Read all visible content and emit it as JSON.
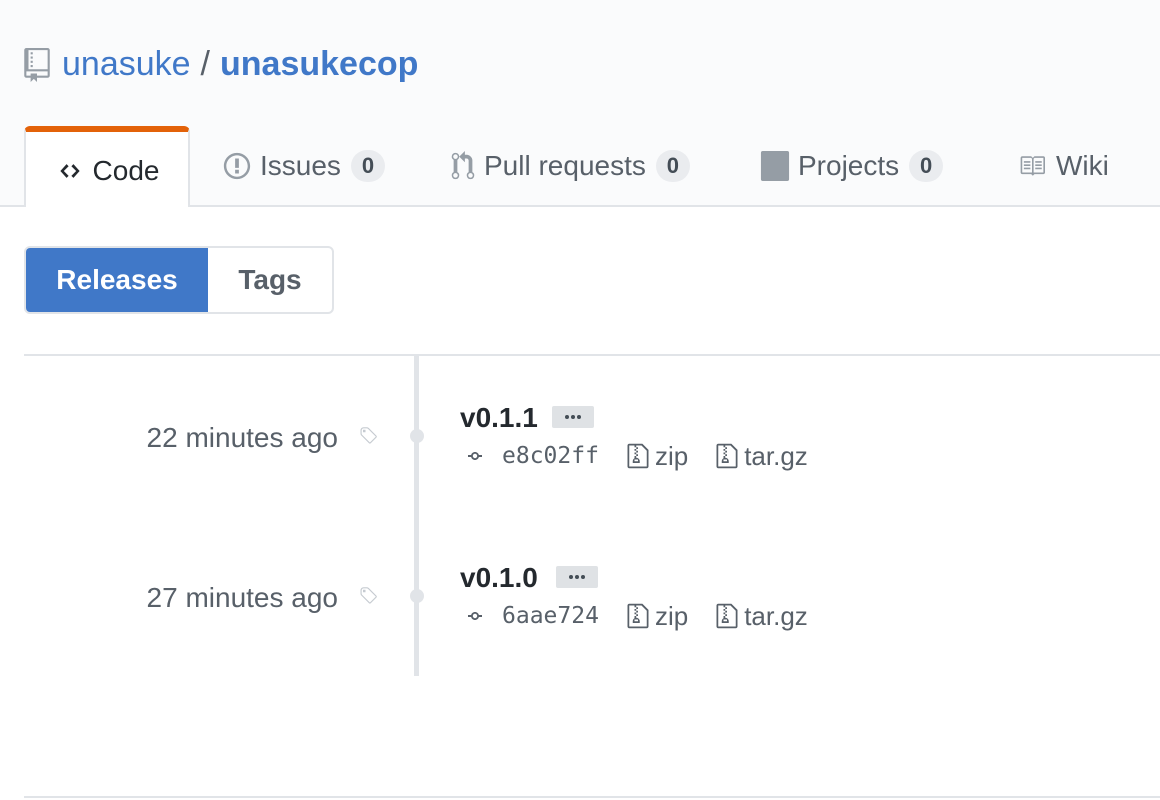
{
  "repo": {
    "owner": "unasuke",
    "separator": "/",
    "name": "unasukecop"
  },
  "tabs": [
    {
      "label": "Code",
      "selected": true
    },
    {
      "label": "Issues",
      "count": "0"
    },
    {
      "label": "Pull requests",
      "count": "0"
    },
    {
      "label": "Projects",
      "count": "0"
    },
    {
      "label": "Wiki"
    }
  ],
  "subnav": {
    "releases": "Releases",
    "tags": "Tags"
  },
  "releases": [
    {
      "date": "22 minutes ago",
      "version": "v0.1.1",
      "commit": "e8c02ff",
      "zip": "zip",
      "targz": "tar.gz"
    },
    {
      "date": "27 minutes ago",
      "version": "v0.1.0",
      "commit": "6aae724",
      "zip": "zip",
      "targz": "tar.gz"
    }
  ],
  "colors": {
    "accent": "#4078c8",
    "tab_highlight": "#e36209",
    "muted": "#586069"
  }
}
